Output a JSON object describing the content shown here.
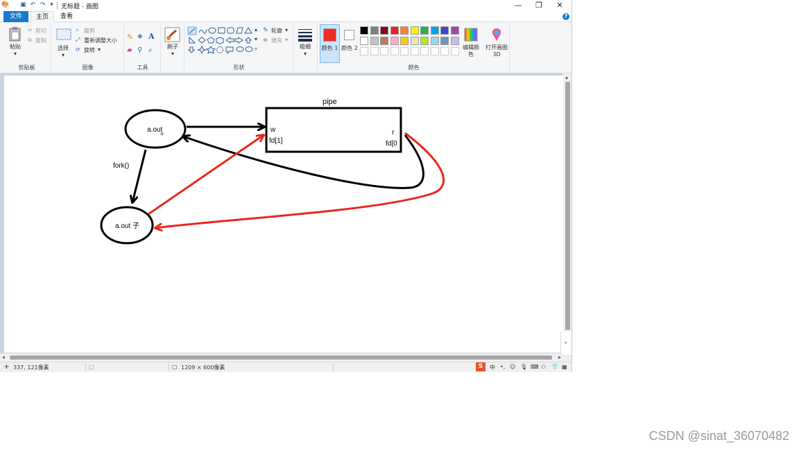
{
  "window": {
    "title": "无标题 - 画图",
    "controls": {
      "minimize": "—",
      "restore": "❐",
      "close": "✕"
    }
  },
  "tabs": [
    {
      "label": "文件"
    },
    {
      "label": "主页"
    },
    {
      "label": "查看"
    }
  ],
  "help": "?",
  "ribbon": {
    "clipboard": {
      "paste": "粘贴",
      "cut": "剪切",
      "copy": "复制",
      "label": "剪贴板"
    },
    "image": {
      "select": "选择",
      "crop": "裁剪",
      "resize": "重新调整大小",
      "rotate": "旋转",
      "label": "图像"
    },
    "tools": {
      "label": "工具",
      "text_tool": "A"
    },
    "brushes": {
      "label": "刷子"
    },
    "shapes": {
      "outline": "轮廓",
      "fill": "填充",
      "label": "形状"
    },
    "size": {
      "label": "粗细"
    },
    "colors": {
      "color1": "颜色 1",
      "color2": "颜色 2",
      "edit": "编辑颜色",
      "paint3d": "打开画图 3D",
      "label": "颜色",
      "color1_value": "#ee2b24",
      "color2_value": "#ffffff",
      "palette_row1": [
        "#000000",
        "#7f7f7f",
        "#880015",
        "#ed1c24",
        "#ff7f27",
        "#fff200",
        "#22b14c",
        "#00a2e8",
        "#3f48cc",
        "#a349a4"
      ],
      "palette_row2": [
        "#ffffff",
        "#c3c3c3",
        "#b97a57",
        "#ffaec9",
        "#ffc90e",
        "#efe4b0",
        "#b5e61d",
        "#99d9ea",
        "#7092be",
        "#c8bfe7"
      ],
      "palette_row3": [
        "#ffffff",
        "#ffffff",
        "#ffffff",
        "#ffffff",
        "#ffffff",
        "#ffffff",
        "#ffffff",
        "#ffffff",
        "#ffffff",
        "#ffffff"
      ]
    }
  },
  "drawing": {
    "pipe_label": "pipe",
    "parent_label": "a.out",
    "child_label": "a.out 子",
    "fork_label": "fork()",
    "write_end": "w",
    "write_fd": "fd[1]",
    "read_end": "r",
    "read_fd": "fd[0",
    "stroke_black": "#000000",
    "stroke_red": "#e8291c"
  },
  "status": {
    "cursor_pos": "337, 121像素",
    "canvas_size": "1209 × 600像素"
  },
  "watermark": "CSDN @sinat_36070482"
}
